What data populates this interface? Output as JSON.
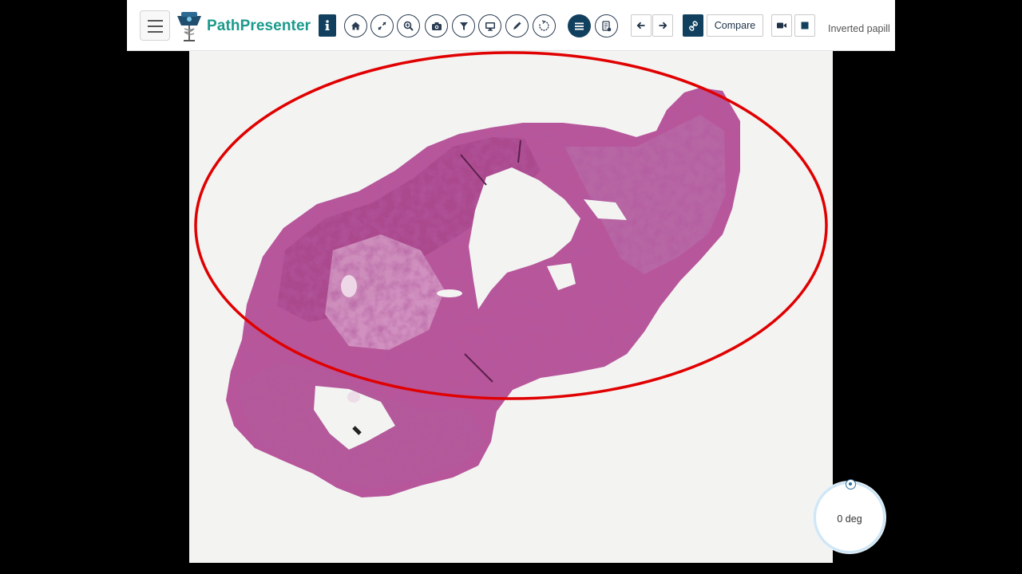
{
  "app": {
    "name": "PathPresenter"
  },
  "toolbar": {
    "icons": [
      "menu-icon",
      "info-icon",
      "home-icon",
      "fullscreen-icon",
      "zoom-icon",
      "camera-icon",
      "filter-icon",
      "monitor-icon",
      "pen-icon",
      "rotate-icon",
      "list-icon",
      "report-icon",
      "arrow-left-icon",
      "arrow-right-icon",
      "link-icon",
      "video-icon",
      "stop-icon"
    ],
    "compare_label": "Compare"
  },
  "slide": {
    "title": "Inverted papill"
  },
  "rotation": {
    "value": 0,
    "label": "0 deg"
  },
  "colors": {
    "brand": "#1b9a8b",
    "toolbar_dark": "#11405f",
    "annotation": "#e00000",
    "tissue": "#b0508f",
    "background": "#000000"
  }
}
